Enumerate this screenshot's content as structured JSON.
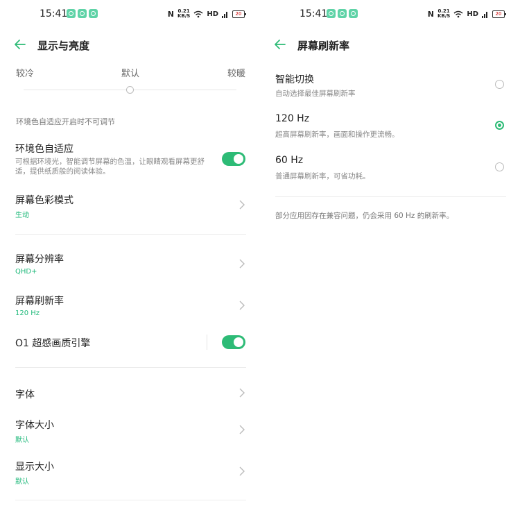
{
  "left": {
    "status": {
      "time": "15:41",
      "speed_top": "0.21",
      "speed_unit": "KB/S",
      "network": "HD",
      "battery": "20"
    },
    "header": {
      "title": "显示与亮度"
    },
    "color_temp": {
      "cool": "较冷",
      "default": "默认",
      "warm": "较暖"
    },
    "note": "环境色自适应开启时不可调节",
    "adaptive": {
      "title": "环境色自适应",
      "desc": "可根据环境光，智能调节屏幕的色温，让眼睛观看屏幕更舒适，提供纸质般的阅读体验。",
      "enabled": true
    },
    "color_mode": {
      "title": "屏幕色彩模式",
      "value": "生动"
    },
    "resolution": {
      "title": "屏幕分辨率",
      "value": "QHD+"
    },
    "refresh": {
      "title": "屏幕刷新率",
      "value": "120 Hz"
    },
    "o1": {
      "title": "O1 超感画质引擎",
      "enabled": true
    },
    "font": {
      "title": "字体"
    },
    "font_size": {
      "title": "字体大小",
      "value": "默认"
    },
    "display_size": {
      "title": "显示大小",
      "value": "默认"
    }
  },
  "right": {
    "status": {
      "time": "15:41",
      "speed_top": "0.21",
      "speed_unit": "KB/S",
      "network": "HD",
      "battery": "20"
    },
    "header": {
      "title": "屏幕刷新率"
    },
    "options": [
      {
        "title": "智能切换",
        "desc": "自动选择最佳屏幕刷新率",
        "selected": false
      },
      {
        "title": "120 Hz",
        "desc": "超高屏幕刷新率，画面和操作更流畅。",
        "selected": true
      },
      {
        "title": "60 Hz",
        "desc": "普通屏幕刷新率，可省功耗。",
        "selected": false
      }
    ],
    "note": "部分应用因存在兼容问题，仍会采用 60 Hz 的刷新率。"
  },
  "colors": {
    "accent": "#2dbb76",
    "notif": "#5fd3a7"
  },
  "icons": [
    "back-arrow-icon",
    "chevron-right-icon",
    "notification-icon",
    "nfc-icon",
    "wifi-icon",
    "signal-icon",
    "battery-icon"
  ]
}
